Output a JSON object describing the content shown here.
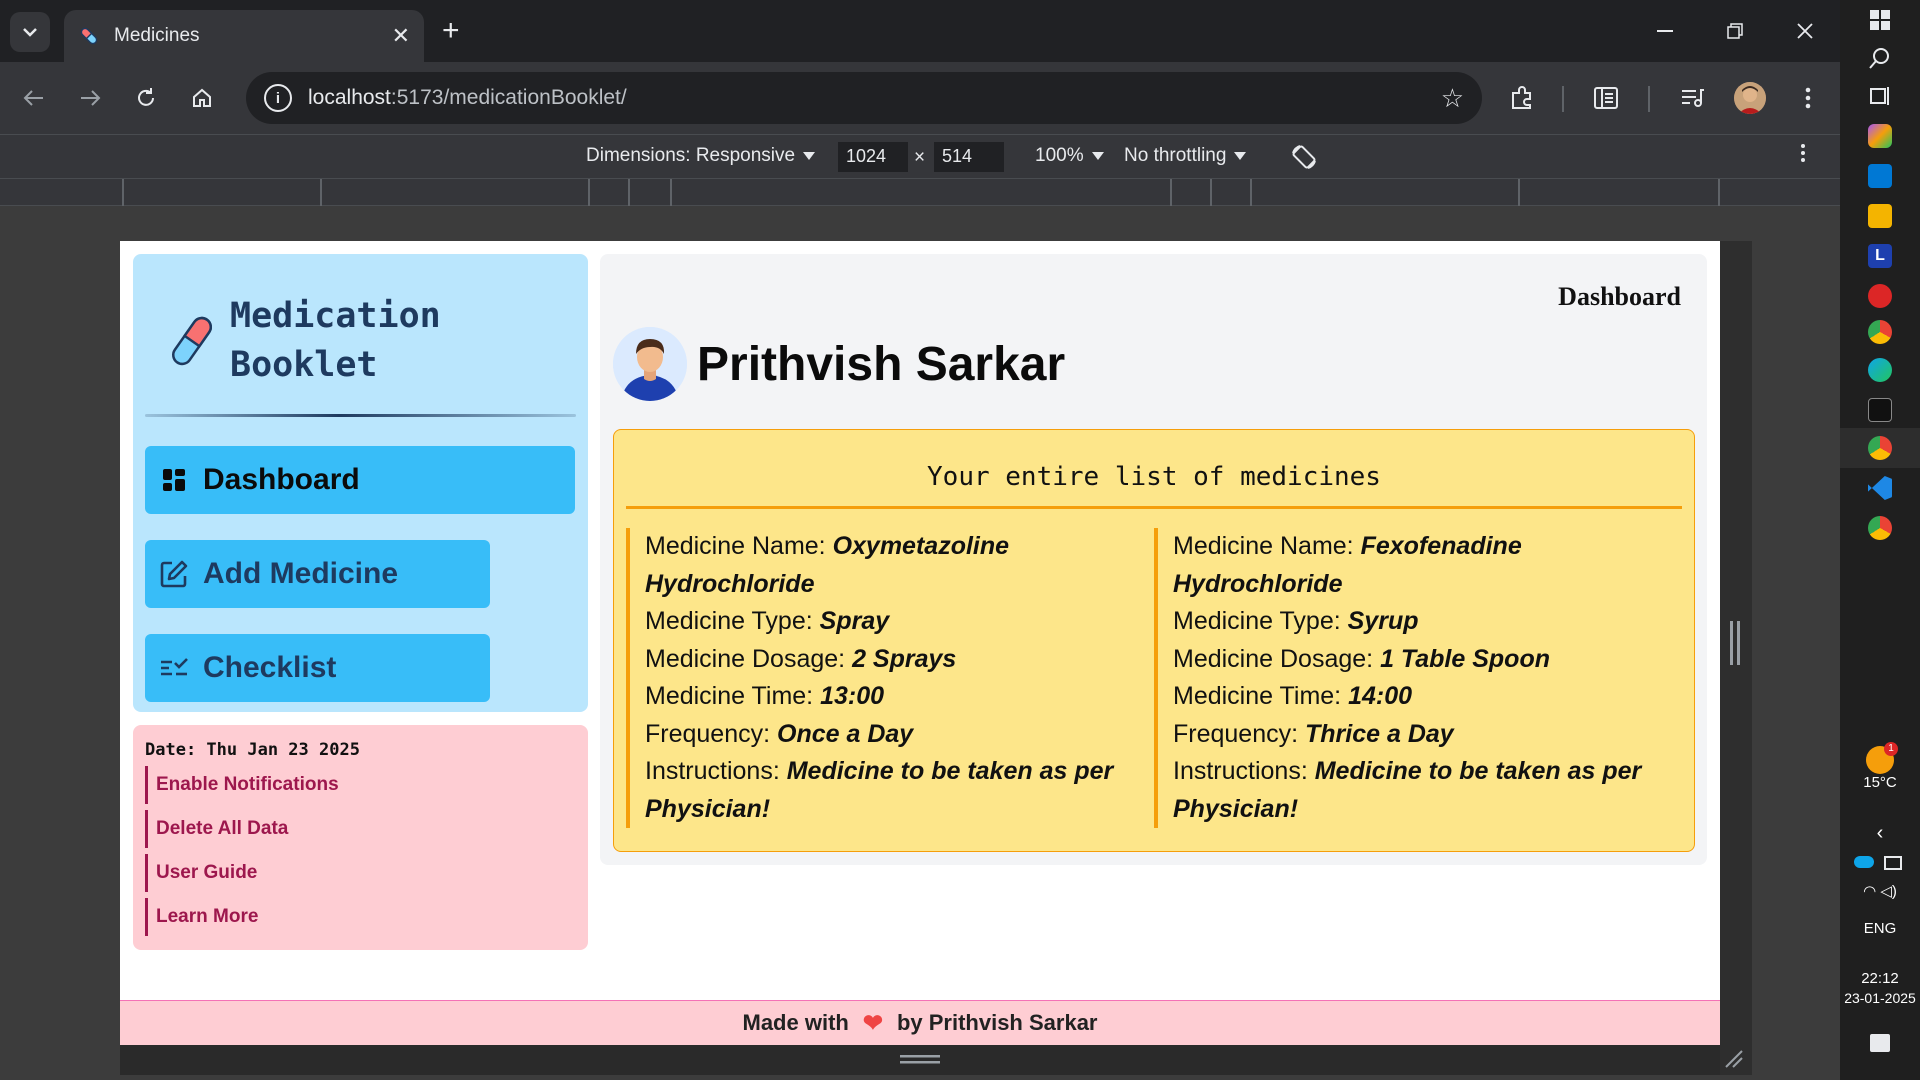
{
  "browser": {
    "tab_title": "Medicines",
    "url_host": "localhost",
    "url_path": ":5173/medicationBooklet/",
    "devtools": {
      "dimensions_label": "Dimensions: Responsive",
      "width": "1024",
      "times": "×",
      "height": "514",
      "zoom": "100%",
      "throttling": "No throttling"
    }
  },
  "taskbar": {
    "temperature": "15°C",
    "language": "ENG",
    "time": "22:12",
    "date": "23-01-2025",
    "notification_count": "1"
  },
  "app": {
    "brand_line1": "Medication",
    "brand_line2": "Booklet",
    "nav": [
      {
        "label": "Dashboard",
        "icon": "dashboard-icon"
      },
      {
        "label": "Add Medicine",
        "icon": "edit-icon"
      },
      {
        "label": "Checklist",
        "icon": "checklist-icon"
      }
    ],
    "date_line": "Date: Thu Jan 23 2025",
    "side_links": [
      "Enable Notifications",
      "Delete All Data",
      "User Guide",
      "Learn More"
    ],
    "breadcrumb": "Dashboard",
    "user_name": "Prithvish Sarkar",
    "list_title": "Your entire list of medicines",
    "field_labels": {
      "name": "Medicine Name: ",
      "type": "Medicine Type: ",
      "dosage": "Medicine Dosage: ",
      "time": "Medicine Time: ",
      "frequency": "Frequency: ",
      "instructions": "Instructions: "
    },
    "medicines": [
      {
        "name": "Oxymetazoline Hydrochloride",
        "type": "Spray",
        "dosage": "2 Sprays",
        "time": "13:00",
        "frequency": "Once a Day",
        "instructions": "Medicine to be taken as per Physician!"
      },
      {
        "name": "Fexofenadine Hydrochloride",
        "type": "Syrup",
        "dosage": "1 Table Spoon",
        "time": "14:00",
        "frequency": "Thrice a Day",
        "instructions": "Medicine to be taken as per Physician!"
      }
    ],
    "footer_prefix": "Made with",
    "footer_suffix": "by Prithvish Sarkar"
  }
}
